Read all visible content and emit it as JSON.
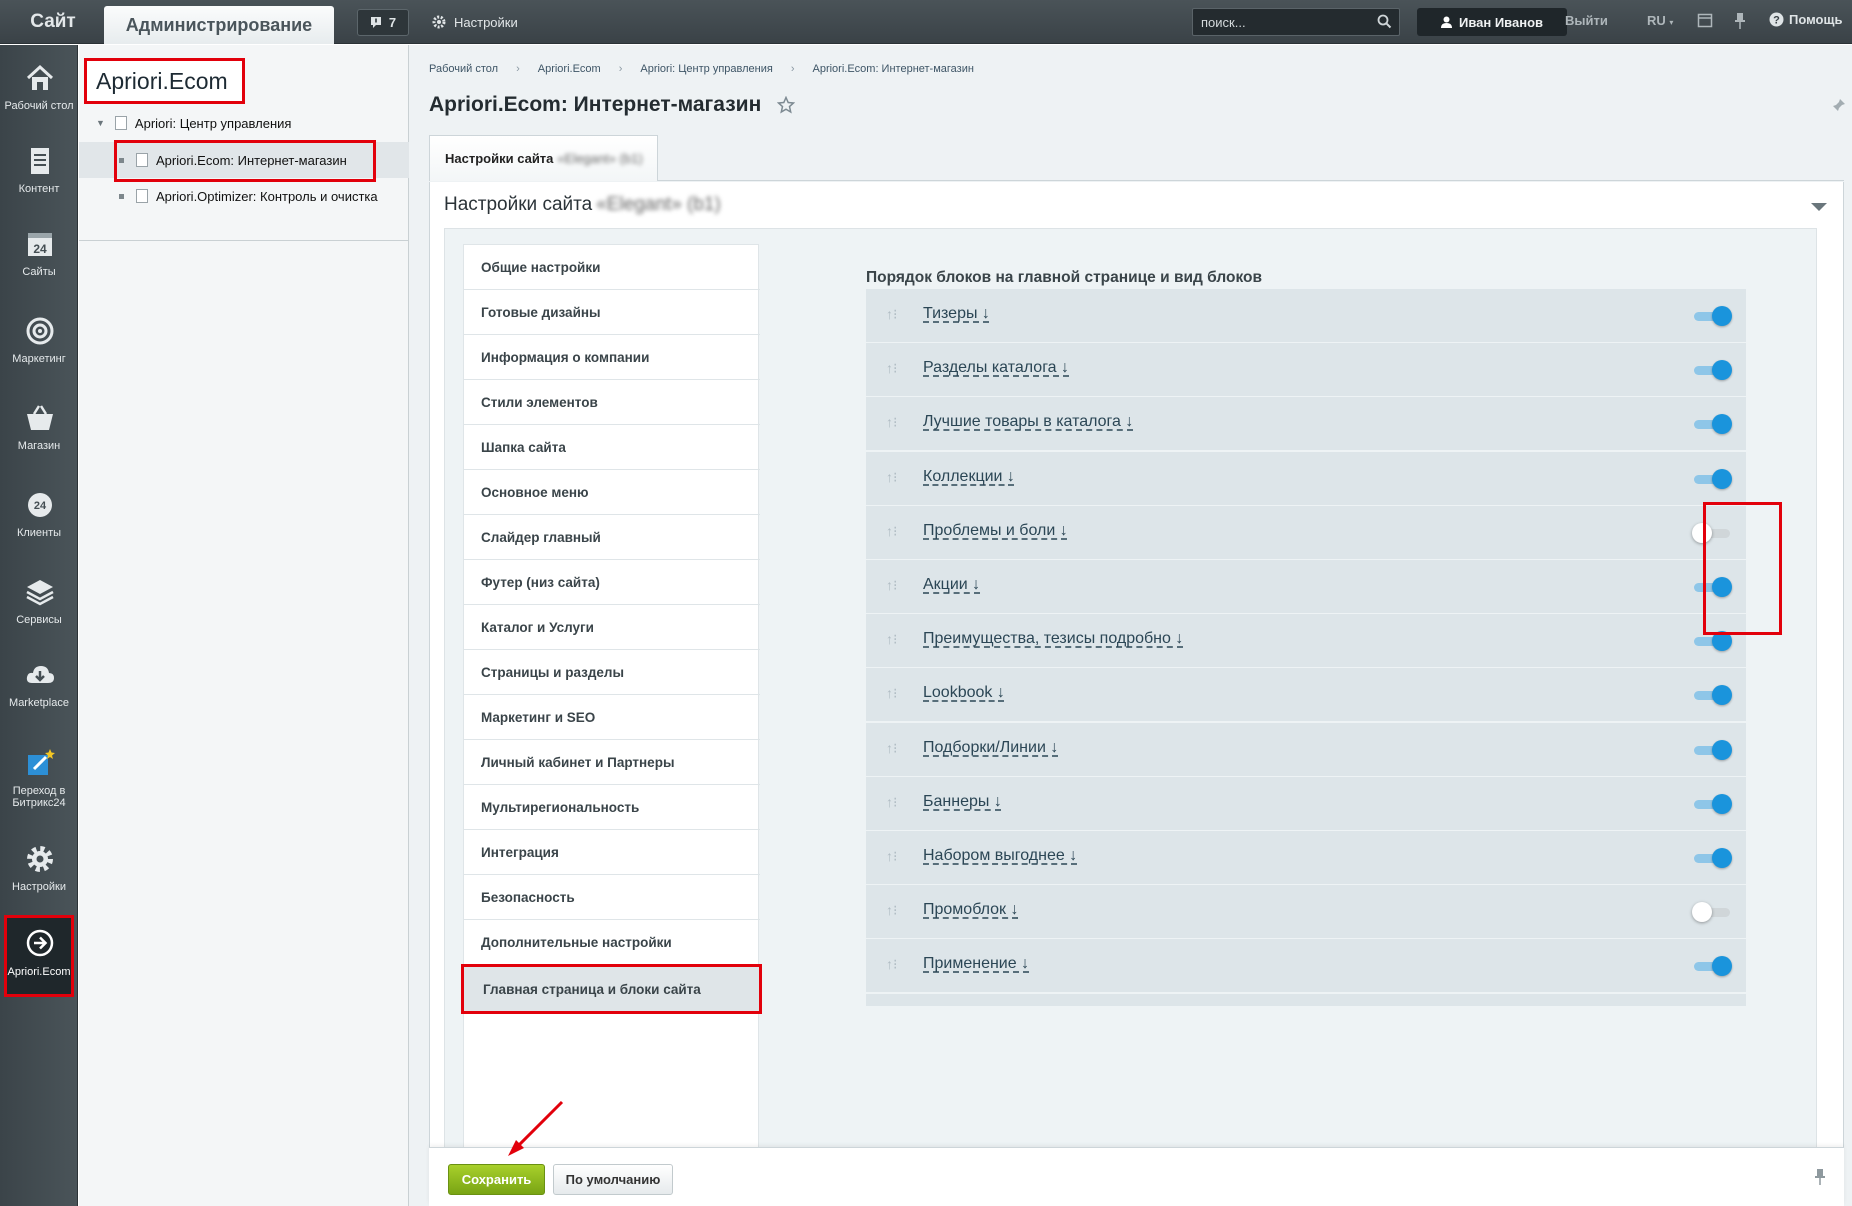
{
  "topbar": {
    "site": "Сайт",
    "admin": "Администрирование",
    "notifications": "7",
    "settings": "Настройки",
    "search_placeholder": "поиск...",
    "user": "Иван Иванов",
    "exit": "Выйти",
    "lang": "RU",
    "help": "Помощь"
  },
  "sidebar": {
    "items": [
      {
        "label": "Рабочий стол",
        "icon": "home-icon"
      },
      {
        "label": "Контент",
        "icon": "document-icon"
      },
      {
        "label": "Сайты",
        "icon": "calendar-24-icon"
      },
      {
        "label": "Маркетинг",
        "icon": "target-icon"
      },
      {
        "label": "Магазин",
        "icon": "basket-icon"
      },
      {
        "label": "Клиенты",
        "icon": "clients-24-icon"
      },
      {
        "label": "Сервисы",
        "icon": "layers-icon"
      },
      {
        "label": "Marketplace",
        "icon": "cloud-download-icon"
      },
      {
        "label": "Переход в Битрикс24",
        "icon": "magic-edit-icon"
      },
      {
        "label": "Настройки",
        "icon": "gear-icon"
      },
      {
        "label": "Apriori.Ecom",
        "icon": "arrow-circle-icon"
      }
    ]
  },
  "tree": {
    "title": "Apriori.Ecom",
    "items": [
      "Apriori: Центр управления",
      "Apriori.Ecom: Интернет-магазин",
      "Apriori.Optimizer: Контроль и очистка"
    ]
  },
  "main": {
    "breadcrumb": [
      "Рабочий стол",
      "Apriori.Ecom",
      "Apriori: Центр управления",
      "Apriori.Ecom: Интернет-магазин"
    ],
    "title": "Apriori.Ecom: Интернет-магазин",
    "tab_label": "Настройки сайта",
    "tab_blurred": "«Elegant» (b1)",
    "panel_title": "Настройки сайта",
    "panel_blurred": "«Elegant» (b1)"
  },
  "settings_menu": [
    "Общие настройки",
    "Готовые дизайны",
    "Информация о компании",
    "Стили элементов",
    "Шапка сайта",
    "Основное меню",
    "Слайдер главный",
    "Футер (низ сайта)",
    "Каталог и Услуги",
    "Страницы и разделы",
    "Маркетинг и SEO",
    "Личный кабинет и Партнеры",
    "Мультирегиональность",
    "Интеграция",
    "Безопасность",
    "Дополнительные настройки",
    "Главная страница и блоки сайта"
  ],
  "blocks": {
    "title": "Порядок блоков на главной странице и вид блоков",
    "items": [
      {
        "name": "Тизеры ↓",
        "enabled": true
      },
      {
        "name": "Разделы каталога ↓",
        "enabled": true
      },
      {
        "name": "Лучшие товары в каталога ↓",
        "enabled": true
      },
      {
        "name": "Коллекции ↓",
        "enabled": true
      },
      {
        "name": "Проблемы и боли ↓",
        "enabled": false
      },
      {
        "name": "Акции ↓",
        "enabled": true
      },
      {
        "name": "Преимущества, тезисы подробно ↓",
        "enabled": true
      },
      {
        "name": "Lookbook ↓",
        "enabled": true
      },
      {
        "name": "Подборки/Линии ↓",
        "enabled": true
      },
      {
        "name": "Баннеры ↓",
        "enabled": true
      },
      {
        "name": "Набором выгоднее ↓",
        "enabled": true
      },
      {
        "name": "Промоблок ↓",
        "enabled": false
      },
      {
        "name": "Применение ↓",
        "enabled": true
      }
    ]
  },
  "footer": {
    "save": "Сохранить",
    "default": "По умолчанию"
  },
  "colors": {
    "accent_toggle": "#1a94dc",
    "save_green": "#8bb81c",
    "highlight_red": "#e2000b"
  }
}
